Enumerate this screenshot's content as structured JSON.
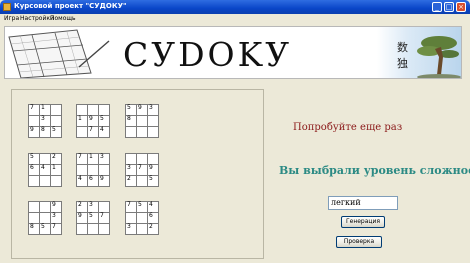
{
  "window": {
    "title": "Курсовой проект \"СУДОКУ\""
  },
  "menu": {
    "items": [
      "Игра",
      "Настройки",
      "Помощь"
    ]
  },
  "banner": {
    "title": "СУDOKУ",
    "kanji": [
      "数",
      "独"
    ]
  },
  "board": {
    "blocks": [
      [
        [
          "7",
          "1",
          ""
        ],
        [
          "",
          "3",
          ""
        ],
        [
          "9",
          "8",
          "5"
        ]
      ],
      [
        [
          "",
          "",
          ""
        ],
        [
          "1",
          "9",
          "5"
        ],
        [
          "",
          "7",
          "4"
        ]
      ],
      [
        [
          "5",
          "9",
          "3"
        ],
        [
          "8",
          "",
          ""
        ],
        [
          "",
          "",
          ""
        ]
      ],
      [
        [
          "5",
          "",
          "2"
        ],
        [
          "6",
          "4",
          "1"
        ],
        [
          "",
          "",
          ""
        ]
      ],
      [
        [
          "7",
          "1",
          "3"
        ],
        [
          "",
          "",
          ""
        ],
        [
          "4",
          "6",
          "9"
        ]
      ],
      [
        [
          "",
          "",
          ""
        ],
        [
          "3",
          "7",
          "9"
        ],
        [
          "2",
          "",
          "5"
        ]
      ],
      [
        [
          "",
          "",
          "9"
        ],
        [
          "",
          "",
          "3"
        ],
        [
          "8",
          "5",
          "7"
        ]
      ],
      [
        [
          "2",
          "3",
          ""
        ],
        [
          "9",
          "5",
          "7"
        ],
        [
          "",
          "",
          ""
        ]
      ],
      [
        [
          "7",
          "5",
          "4"
        ],
        [
          "",
          "",
          "6"
        ],
        [
          "3",
          "",
          "2"
        ]
      ]
    ]
  },
  "messages": {
    "try_again": "Попробуйте еще раз",
    "level_prompt": "Вы выбрали уровень сложности"
  },
  "level_field": {
    "value": "легкий"
  },
  "buttons": {
    "generate": "Генерация",
    "check": "Проверка"
  },
  "colors": {
    "title_bar": "#0a46c8",
    "try_again": "#8b1a1a",
    "level_prompt": "#2b8a84"
  }
}
